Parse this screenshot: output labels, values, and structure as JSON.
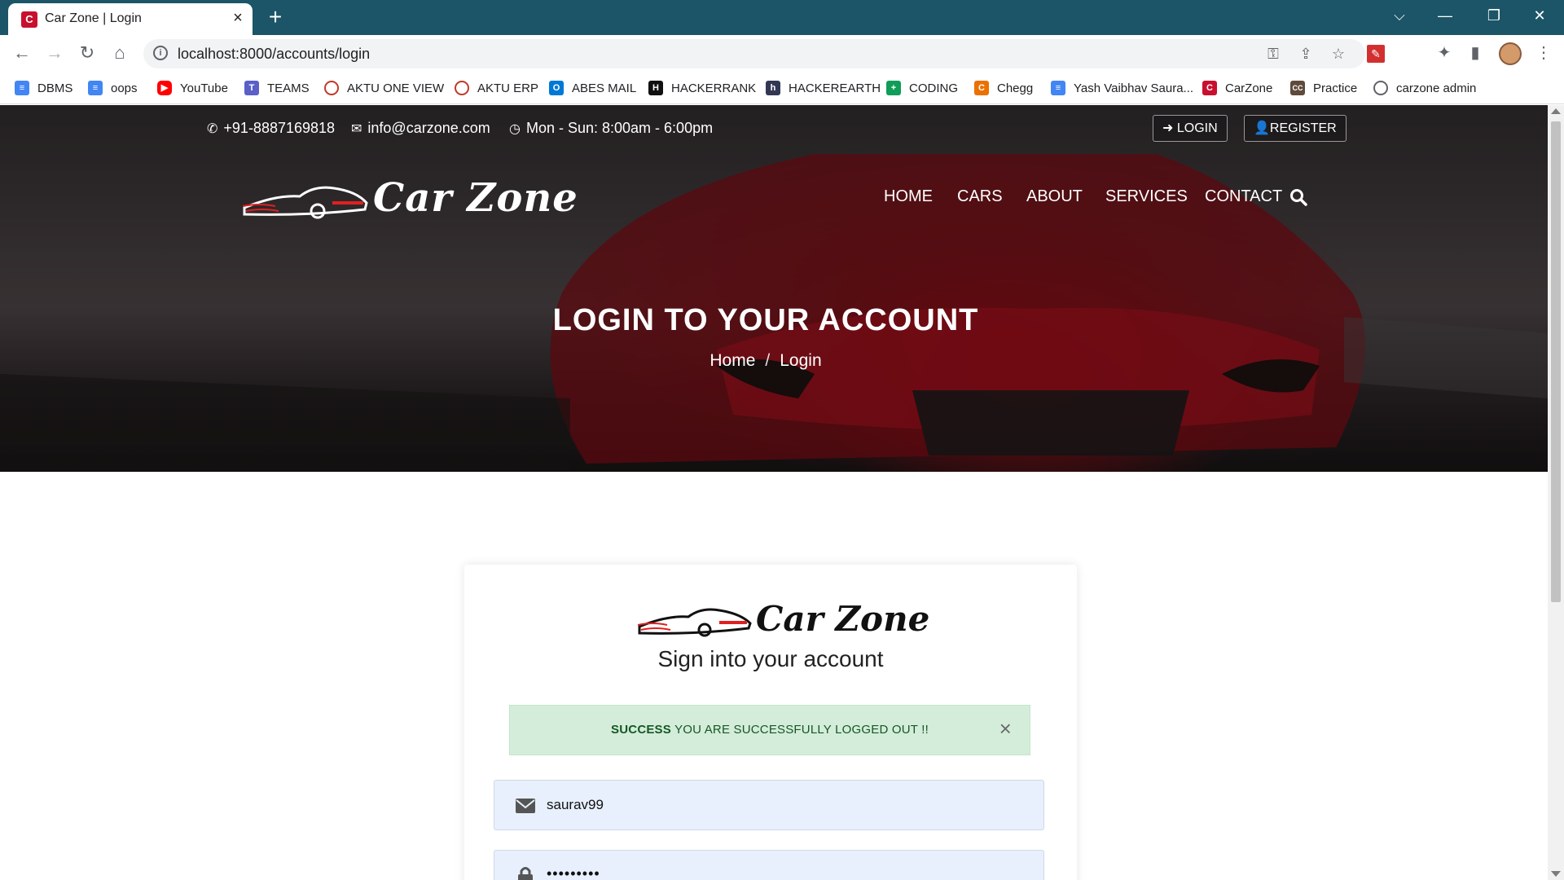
{
  "browser": {
    "tab_title": "Car Zone | Login",
    "tab_favicon_letter": "C",
    "url": "localhost:8000/accounts/login",
    "accent_color": "#1b5567"
  },
  "bookmarks": [
    {
      "label": "DBMS",
      "icon": "doc-icon",
      "color": "#4285f4"
    },
    {
      "label": "oops",
      "icon": "doc-icon",
      "color": "#4285f4"
    },
    {
      "label": "YouTube",
      "icon": "youtube-icon",
      "color": "#ff0000"
    },
    {
      "label": "TEAMS",
      "icon": "teams-icon",
      "color": "#5b5fc7"
    },
    {
      "label": "AKTU ONE VIEW",
      "icon": "aktu-icon",
      "color": "#c0392b"
    },
    {
      "label": "AKTU ERP",
      "icon": "aktu-icon",
      "color": "#c0392b"
    },
    {
      "label": "ABES MAIL",
      "icon": "outlook-icon",
      "color": "#0078d4"
    },
    {
      "label": "HACKERRANK",
      "icon": "hackerrank-icon",
      "color": "#111111"
    },
    {
      "label": "HACKEREARTH",
      "icon": "hackerearth-icon",
      "color": "#323754"
    },
    {
      "label": "CODING",
      "icon": "sheets-icon",
      "color": "#0f9d58"
    },
    {
      "label": "Chegg",
      "icon": "chegg-icon",
      "color": "#eb7100"
    },
    {
      "label": "Yash Vaibhav Saura...",
      "icon": "doc-icon",
      "color": "#4285f4"
    },
    {
      "label": "CarZone",
      "icon": "carzone-icon",
      "color": "#c8102e"
    },
    {
      "label": "Practice",
      "icon": "cc-icon",
      "color": "#5f4b3b"
    },
    {
      "label": "carzone admin",
      "icon": "globe-icon",
      "color": "#5f6368"
    }
  ],
  "topbar": {
    "phone": "+91-8887169818",
    "email": "info@carzone.com",
    "hours": "Mon - Sun: 8:00am - 6:00pm",
    "login_label": "LOGIN",
    "register_label": "REGISTER"
  },
  "brand": {
    "logo_text": "Car Zone"
  },
  "nav": {
    "home": "HOME",
    "cars": "CARS",
    "about": "ABOUT",
    "services": "SERVICES",
    "contact": "CONTACT"
  },
  "hero": {
    "title": "LOGIN TO YOUR ACCOUNT",
    "breadcrumb_home": "Home",
    "breadcrumb_sep": "/",
    "breadcrumb_current": "Login"
  },
  "login": {
    "heading": "Sign into your account",
    "alert_strong": "SUCCESS",
    "alert_text": " YOU ARE SUCCESSFULLY LOGGED OUT !!",
    "alert_close": "×",
    "alert_color": "#d4edda",
    "username_value": "saurav99",
    "password_value": "•••••••••",
    "field_bg": "#e8f0fe"
  }
}
